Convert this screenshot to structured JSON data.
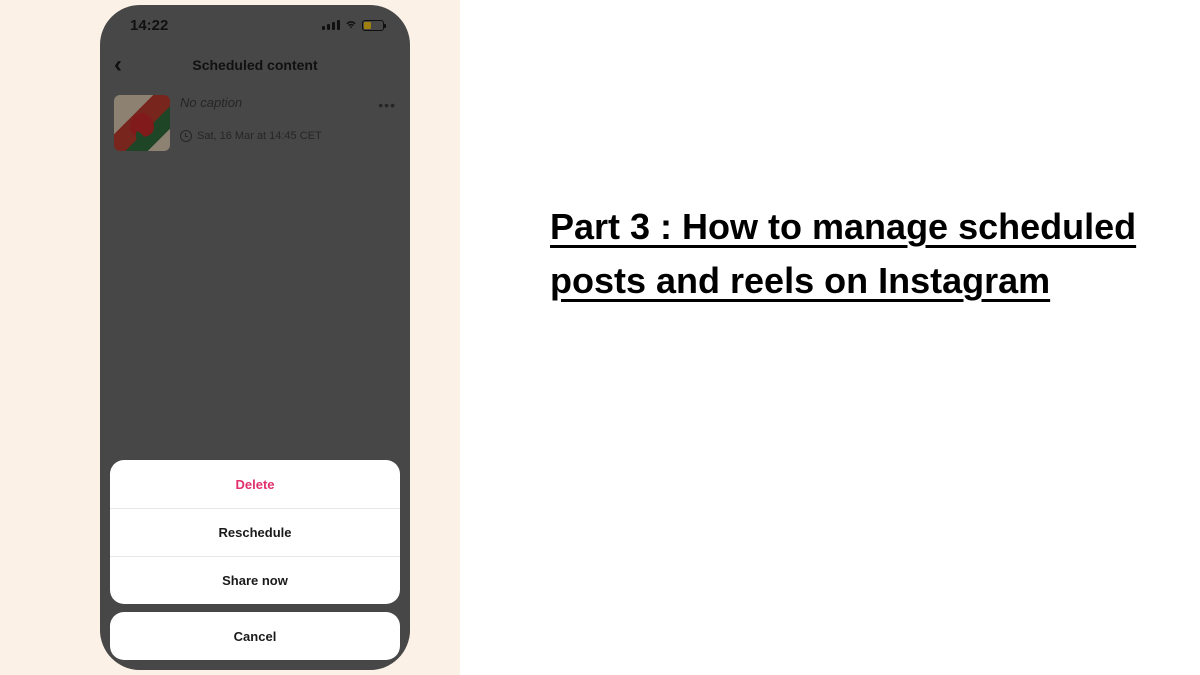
{
  "statusbar": {
    "time": "14:22"
  },
  "header": {
    "title": "Scheduled content"
  },
  "post": {
    "caption": "No caption",
    "scheduled_at": "Sat, 16 Mar at 14:45 CET"
  },
  "sheet": {
    "delete": "Delete",
    "reschedule": "Reschedule",
    "share_now": "Share now",
    "cancel": "Cancel"
  },
  "headline": "Part 3 : How to manage scheduled posts and reels on Instagram"
}
